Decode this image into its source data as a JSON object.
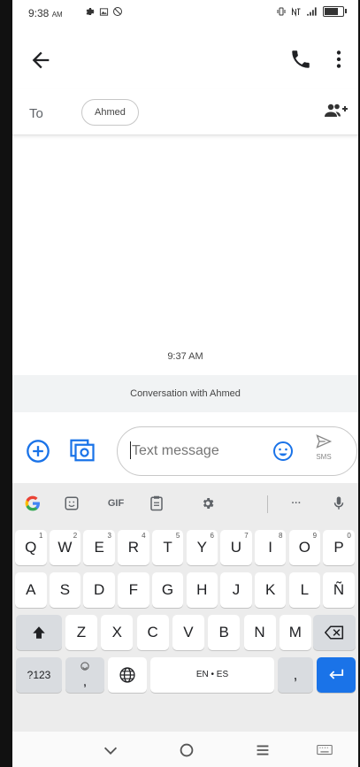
{
  "status_bar": {
    "time": "9:38",
    "ampm": "AM"
  },
  "contact": {
    "to_label": "To",
    "chip": "Ahmed"
  },
  "conversation": {
    "timestamp": "9:37 AM",
    "banner": "Conversation with Ahmed"
  },
  "compose": {
    "placeholder": "Text message",
    "send_label": "SMS"
  },
  "keyboard": {
    "toolbar": {
      "gif": "GIF",
      "more": "···"
    },
    "row1": [
      {
        "k": "Q",
        "h": "1"
      },
      {
        "k": "W",
        "h": "2"
      },
      {
        "k": "E",
        "h": "3"
      },
      {
        "k": "R",
        "h": "4"
      },
      {
        "k": "T",
        "h": "5"
      },
      {
        "k": "Y",
        "h": "6"
      },
      {
        "k": "U",
        "h": "7"
      },
      {
        "k": "I",
        "h": "8"
      },
      {
        "k": "O",
        "h": "9"
      },
      {
        "k": "P",
        "h": "0"
      }
    ],
    "row2": [
      "A",
      "S",
      "D",
      "F",
      "G",
      "H",
      "J",
      "K",
      "L",
      "Ñ"
    ],
    "row3": [
      "Z",
      "X",
      "C",
      "V",
      "B",
      "N",
      "M"
    ],
    "symbols": "?123",
    "space": "EN • ES",
    "period": ",",
    "comma_key": ","
  },
  "colors": {
    "accent": "#1a73e8",
    "google_red": "#ea4335",
    "keyboard_bg": "#ececec"
  }
}
